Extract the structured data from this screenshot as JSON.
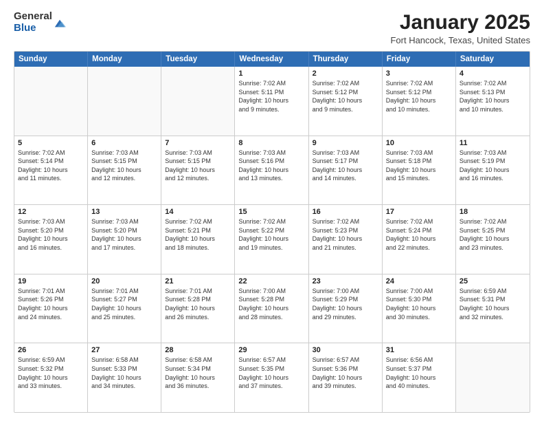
{
  "logo": {
    "general": "General",
    "blue": "Blue"
  },
  "title": "January 2025",
  "location": "Fort Hancock, Texas, United States",
  "weekdays": [
    "Sunday",
    "Monday",
    "Tuesday",
    "Wednesday",
    "Thursday",
    "Friday",
    "Saturday"
  ],
  "rows": [
    [
      {
        "day": "",
        "text": ""
      },
      {
        "day": "",
        "text": ""
      },
      {
        "day": "",
        "text": ""
      },
      {
        "day": "1",
        "text": "Sunrise: 7:02 AM\nSunset: 5:11 PM\nDaylight: 10 hours\nand 9 minutes."
      },
      {
        "day": "2",
        "text": "Sunrise: 7:02 AM\nSunset: 5:12 PM\nDaylight: 10 hours\nand 9 minutes."
      },
      {
        "day": "3",
        "text": "Sunrise: 7:02 AM\nSunset: 5:12 PM\nDaylight: 10 hours\nand 10 minutes."
      },
      {
        "day": "4",
        "text": "Sunrise: 7:02 AM\nSunset: 5:13 PM\nDaylight: 10 hours\nand 10 minutes."
      }
    ],
    [
      {
        "day": "5",
        "text": "Sunrise: 7:02 AM\nSunset: 5:14 PM\nDaylight: 10 hours\nand 11 minutes."
      },
      {
        "day": "6",
        "text": "Sunrise: 7:03 AM\nSunset: 5:15 PM\nDaylight: 10 hours\nand 12 minutes."
      },
      {
        "day": "7",
        "text": "Sunrise: 7:03 AM\nSunset: 5:15 PM\nDaylight: 10 hours\nand 12 minutes."
      },
      {
        "day": "8",
        "text": "Sunrise: 7:03 AM\nSunset: 5:16 PM\nDaylight: 10 hours\nand 13 minutes."
      },
      {
        "day": "9",
        "text": "Sunrise: 7:03 AM\nSunset: 5:17 PM\nDaylight: 10 hours\nand 14 minutes."
      },
      {
        "day": "10",
        "text": "Sunrise: 7:03 AM\nSunset: 5:18 PM\nDaylight: 10 hours\nand 15 minutes."
      },
      {
        "day": "11",
        "text": "Sunrise: 7:03 AM\nSunset: 5:19 PM\nDaylight: 10 hours\nand 16 minutes."
      }
    ],
    [
      {
        "day": "12",
        "text": "Sunrise: 7:03 AM\nSunset: 5:20 PM\nDaylight: 10 hours\nand 16 minutes."
      },
      {
        "day": "13",
        "text": "Sunrise: 7:03 AM\nSunset: 5:20 PM\nDaylight: 10 hours\nand 17 minutes."
      },
      {
        "day": "14",
        "text": "Sunrise: 7:02 AM\nSunset: 5:21 PM\nDaylight: 10 hours\nand 18 minutes."
      },
      {
        "day": "15",
        "text": "Sunrise: 7:02 AM\nSunset: 5:22 PM\nDaylight: 10 hours\nand 19 minutes."
      },
      {
        "day": "16",
        "text": "Sunrise: 7:02 AM\nSunset: 5:23 PM\nDaylight: 10 hours\nand 21 minutes."
      },
      {
        "day": "17",
        "text": "Sunrise: 7:02 AM\nSunset: 5:24 PM\nDaylight: 10 hours\nand 22 minutes."
      },
      {
        "day": "18",
        "text": "Sunrise: 7:02 AM\nSunset: 5:25 PM\nDaylight: 10 hours\nand 23 minutes."
      }
    ],
    [
      {
        "day": "19",
        "text": "Sunrise: 7:01 AM\nSunset: 5:26 PM\nDaylight: 10 hours\nand 24 minutes."
      },
      {
        "day": "20",
        "text": "Sunrise: 7:01 AM\nSunset: 5:27 PM\nDaylight: 10 hours\nand 25 minutes."
      },
      {
        "day": "21",
        "text": "Sunrise: 7:01 AM\nSunset: 5:28 PM\nDaylight: 10 hours\nand 26 minutes."
      },
      {
        "day": "22",
        "text": "Sunrise: 7:00 AM\nSunset: 5:28 PM\nDaylight: 10 hours\nand 28 minutes."
      },
      {
        "day": "23",
        "text": "Sunrise: 7:00 AM\nSunset: 5:29 PM\nDaylight: 10 hours\nand 29 minutes."
      },
      {
        "day": "24",
        "text": "Sunrise: 7:00 AM\nSunset: 5:30 PM\nDaylight: 10 hours\nand 30 minutes."
      },
      {
        "day": "25",
        "text": "Sunrise: 6:59 AM\nSunset: 5:31 PM\nDaylight: 10 hours\nand 32 minutes."
      }
    ],
    [
      {
        "day": "26",
        "text": "Sunrise: 6:59 AM\nSunset: 5:32 PM\nDaylight: 10 hours\nand 33 minutes."
      },
      {
        "day": "27",
        "text": "Sunrise: 6:58 AM\nSunset: 5:33 PM\nDaylight: 10 hours\nand 34 minutes."
      },
      {
        "day": "28",
        "text": "Sunrise: 6:58 AM\nSunset: 5:34 PM\nDaylight: 10 hours\nand 36 minutes."
      },
      {
        "day": "29",
        "text": "Sunrise: 6:57 AM\nSunset: 5:35 PM\nDaylight: 10 hours\nand 37 minutes."
      },
      {
        "day": "30",
        "text": "Sunrise: 6:57 AM\nSunset: 5:36 PM\nDaylight: 10 hours\nand 39 minutes."
      },
      {
        "day": "31",
        "text": "Sunrise: 6:56 AM\nSunset: 5:37 PM\nDaylight: 10 hours\nand 40 minutes."
      },
      {
        "day": "",
        "text": ""
      }
    ]
  ]
}
